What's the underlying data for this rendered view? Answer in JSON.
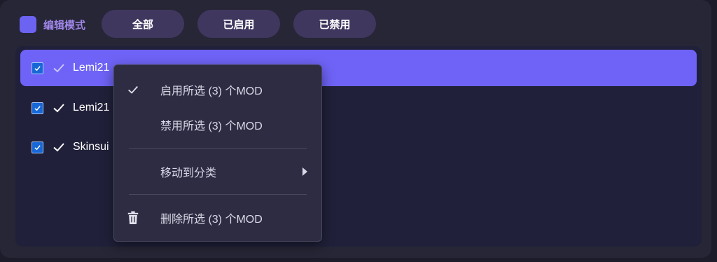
{
  "toolbar": {
    "edit_mode_label": "编辑模式",
    "filters": [
      {
        "label": "全部"
      },
      {
        "label": "已启用"
      },
      {
        "label": "已禁用"
      }
    ]
  },
  "mod_list": {
    "items": [
      {
        "name": "Lemi21",
        "checked": true,
        "enabled": true,
        "selected": true
      },
      {
        "name": "Lemi21",
        "checked": true,
        "enabled": true,
        "selected": false
      },
      {
        "name": "Skinsui",
        "checked": true,
        "enabled": true,
        "selected": false
      }
    ]
  },
  "context_menu": {
    "enable_selected": {
      "label": "启用所选 (3) 个MOD",
      "icon": "check-icon"
    },
    "disable_selected": {
      "label": "禁用所选 (3) 个MOD"
    },
    "move_to_category": {
      "label": "移动到分类",
      "icon": "chevron-right-icon"
    },
    "delete_selected": {
      "label": "删除所选 (3) 个MOD",
      "icon": "trash-icon"
    }
  },
  "colors": {
    "accent": "#6e63f6",
    "checkbox": "#1767d6",
    "menu_bg": "#2d2c43",
    "filter_bg": "#40375f"
  }
}
